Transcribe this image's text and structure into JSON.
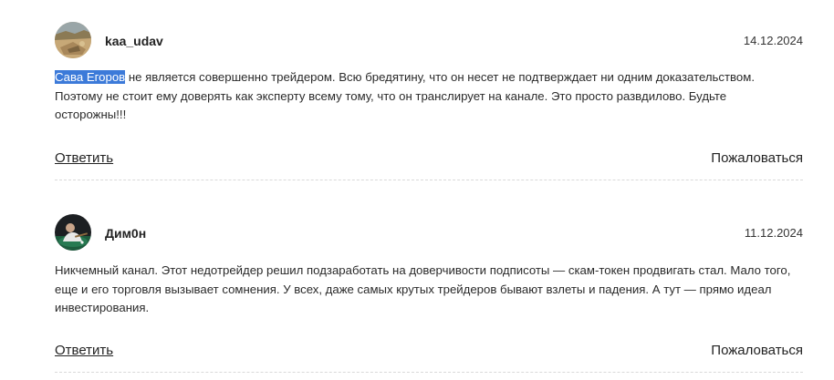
{
  "comments": [
    {
      "username": "kaa_udav",
      "date": "14.12.2024",
      "mention": "Сава Егоров",
      "text": " не является совершенно трейдером. Всю бредятину, что он несет не подтверждает ни одним доказательством. Поэтому не стоит ему доверять как эксперту всему тому, что он транслирует на канале. Это просто развдилово. Будьте осторожны!!!",
      "reply_label": "Ответить",
      "report_label": "Пожаловаться",
      "avatar_icon": "user-photo-landscape",
      "mention_highlight_color": "#3c7ad9"
    },
    {
      "username": "Дим0н",
      "date": "11.12.2024",
      "text": "Никчемный канал. Этот недотрейдер решил подзаработать на доверчивости подписоты — скам-токен продвигать стал. Мало того, еще и его торговля вызывает сомнения. У всех, даже самых крутых трейдеров бывают взлеты и падения. А тут — прямо идеал инвестирования.",
      "reply_label": "Ответить",
      "report_label": "Пожаловаться",
      "avatar_icon": "user-photo-person"
    }
  ]
}
